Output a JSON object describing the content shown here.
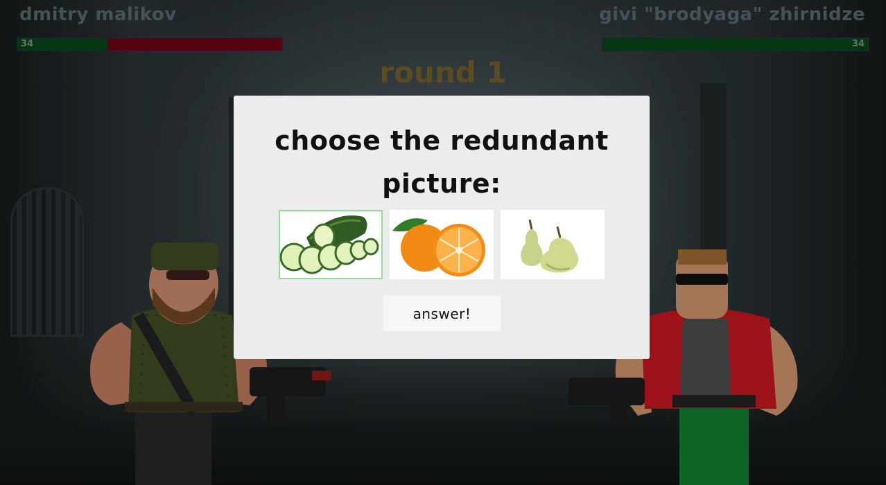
{
  "player_left": {
    "name": "dmitry malikov",
    "hp": 34,
    "hp_fraction": 0.34
  },
  "player_right": {
    "name": "givi \"brodyaga\" zhirnidze",
    "hp": 34,
    "hp_fraction": 1.0
  },
  "round_label": "round 1",
  "modal": {
    "title": "choose the redundant picture:",
    "options": [
      {
        "subject": "cucumber",
        "icon": "cucumber-image",
        "selected": true
      },
      {
        "subject": "orange",
        "icon": "orange-image",
        "selected": false
      },
      {
        "subject": "pear",
        "icon": "pear-image",
        "selected": false
      }
    ],
    "answer_label": "answer!"
  },
  "colors": {
    "hp_fill": "#07441a",
    "hp_empty": "#6a0613",
    "round": "#6d5c2a",
    "selected_outline": "#8ee08e"
  }
}
